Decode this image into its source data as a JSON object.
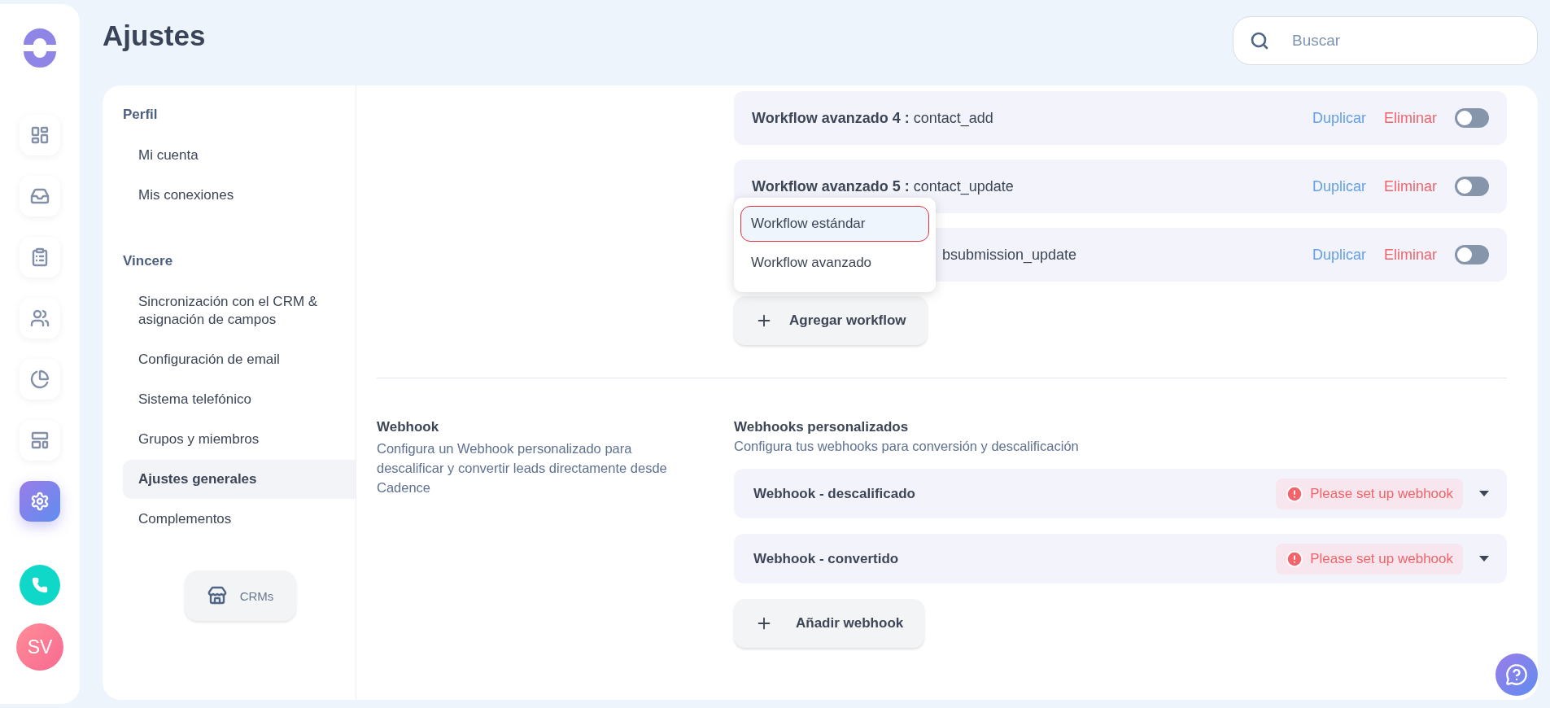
{
  "rail": {
    "nav_icons": [
      {
        "selected": false
      },
      {
        "selected": false
      },
      {
        "selected": false
      },
      {
        "selected": false
      },
      {
        "selected": false
      },
      {
        "selected": false
      },
      {
        "selected": true
      }
    ],
    "avatar": "SV"
  },
  "header": {
    "title": "Ajustes",
    "search": {
      "placeholder": "Buscar"
    }
  },
  "settings_nav": {
    "groups": [
      {
        "title": "Perfil",
        "items": [
          {
            "label": "Mi cuenta",
            "selected": false
          },
          {
            "label": "Mis conexiones",
            "selected": false
          }
        ]
      },
      {
        "title": "Vincere",
        "items": [
          {
            "label": "Sincronización con el CRM & asignación de campos",
            "selected": false
          },
          {
            "label": "Configuración de email",
            "selected": false
          },
          {
            "label": "Sistema telefónico",
            "selected": false
          },
          {
            "label": "Grupos y miembros",
            "selected": false
          },
          {
            "label": "Ajustes generales",
            "selected": true
          },
          {
            "label": "Complementos",
            "selected": false
          }
        ]
      }
    ],
    "crms_button": "CRMs"
  },
  "workflows": {
    "rows": [
      {
        "name": "Workflow avanzado 4 :",
        "trigger": "contact_add",
        "duplicate": "Duplicar",
        "delete": "Eliminar",
        "on": false
      },
      {
        "name": "Workflow avanzado 5 :",
        "trigger": "contact_update",
        "duplicate": "Duplicar",
        "delete": "Eliminar",
        "on": false
      },
      {
        "trigger": "bsubmission_update",
        "duplicate": "Duplicar",
        "delete": "Eliminar",
        "on": false
      }
    ],
    "menu": [
      {
        "label": "Workflow estándar",
        "selected": true
      },
      {
        "label": "Workflow avanzado",
        "selected": false
      }
    ],
    "add_button": "Agregar workflow"
  },
  "webhook": {
    "title": "Webhook",
    "description": "Configura un Webhook personalizado para descalificar y convertir leads directamente desde Cadence",
    "heading": "Webhooks personalizados",
    "subheading": "Configura tus webhooks para conversión y descalificación",
    "rows": [
      {
        "name": "Webhook - descalificado",
        "status": "Please set up webhook"
      },
      {
        "name": "Webhook - convertido",
        "status": "Please set up webhook"
      }
    ],
    "add_button": "Añadir webhook"
  }
}
